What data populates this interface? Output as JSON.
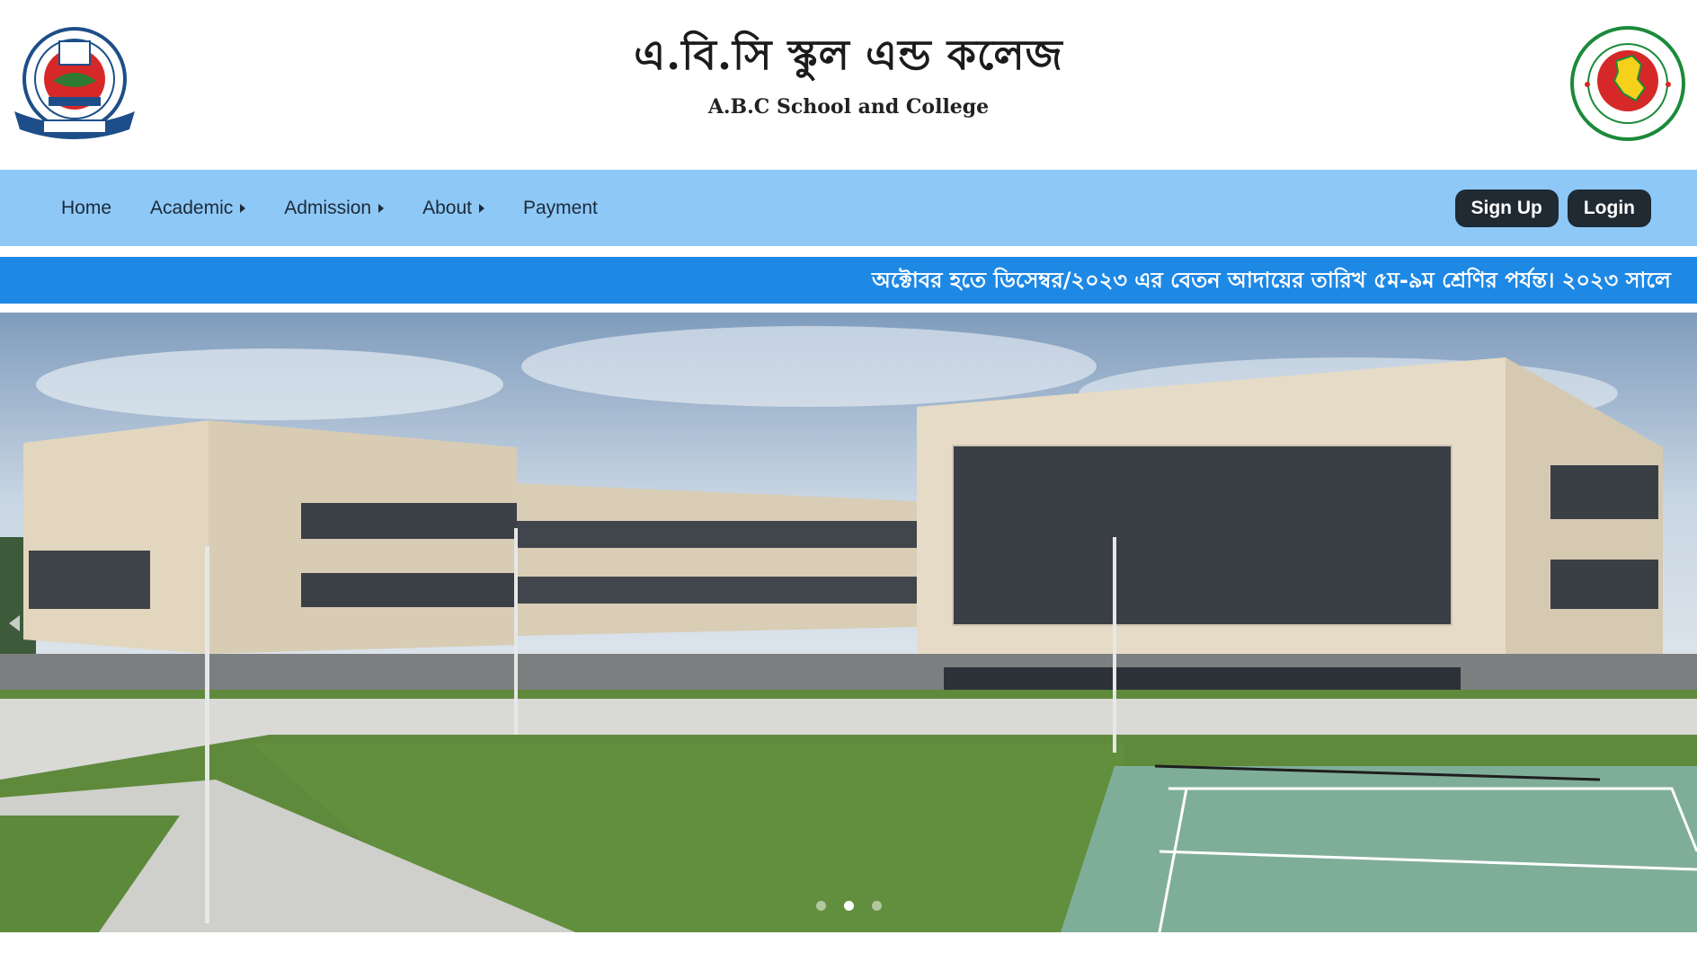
{
  "header": {
    "title_bn": "এ.বি.সি স্কুল এন্ড কলেজ",
    "title_en": "A.B.C School and College",
    "left_logo_icon": "education-board-seal-icon",
    "right_logo_icon": "bangladesh-government-seal-icon"
  },
  "nav": {
    "items": [
      {
        "label": "Home",
        "has_submenu": false
      },
      {
        "label": "Academic",
        "has_submenu": true
      },
      {
        "label": "Admission",
        "has_submenu": true
      },
      {
        "label": "About",
        "has_submenu": true
      },
      {
        "label": "Payment",
        "has_submenu": false
      }
    ],
    "signup_label": "Sign Up",
    "login_label": "Login"
  },
  "notice": {
    "text": "অক্টোবর হতে ডিসেম্বর/২০২৩ এর বেতন আদায়ের তারিখ ৫ম-৯ম শ্রেণির পর্যন্ত। ২০২৩ সালে"
  },
  "slider": {
    "slide_count": 3,
    "active_index": 1
  },
  "colors": {
    "nav_bg": "#8ec8f7",
    "ticker_bg": "#1e88e5",
    "button_bg": "#1f2a33"
  }
}
